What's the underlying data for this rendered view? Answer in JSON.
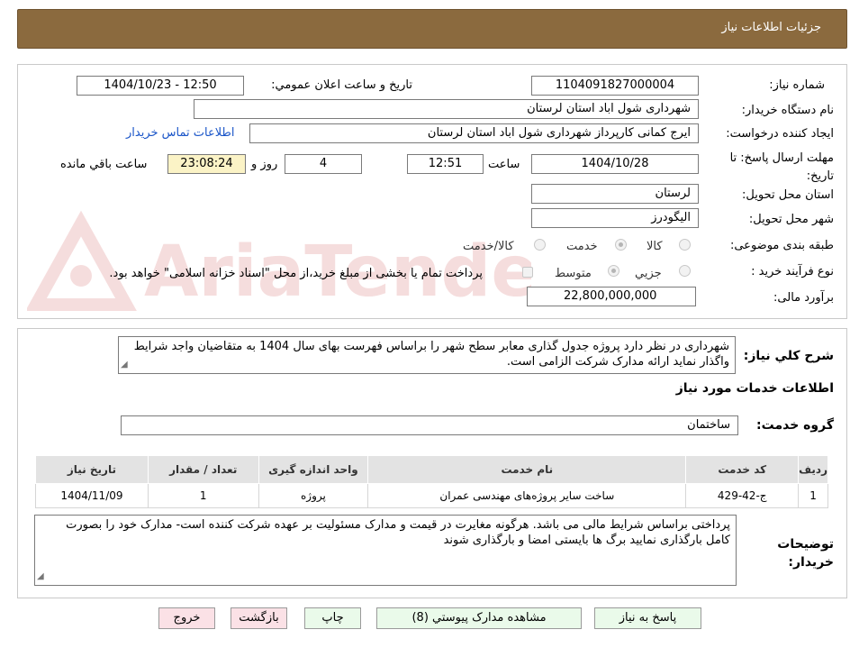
{
  "header": {
    "title": "جزئيات اطلاعات نياز"
  },
  "form": {
    "need_number_label": "شماره نياز:",
    "need_number": "1104091827000004",
    "announce_label": "تاريخ و ساعت اعلان عمومي:",
    "announce_value": "1404/10/23 - 12:50",
    "buyer_org_label": "نام دستگاه خريدار:",
    "buyer_org": "شهرداری شول اباد استان لرستان",
    "creator_label": "ايجاد کننده درخواست:",
    "creator": "ایرج کمانی کارپرداز شهرداری شول اباد استان لرستان",
    "contact_link": "اطلاعات تماس خريدار",
    "deadline_label": "مهلت ارسال پاسخ: تا تاريخ:",
    "deadline_date": "1404/10/28",
    "time_label": "ساعت",
    "deadline_time": "12:51",
    "days_value": "4",
    "days_label": "روز و",
    "remaining_time": "23:08:24",
    "remaining_label": "ساعت باقي مانده",
    "province_label": "استان محل تحويل:",
    "province": "لرستان",
    "city_label": "شهر محل تحويل:",
    "city": "الیگودرز",
    "category_label": "طبقه بندی موضوعی:",
    "category_options": [
      "کالا",
      "خدمت",
      "کالا/خدمت"
    ],
    "process_label": "نوع فرآيند خريد :",
    "process_options": [
      "جزيي",
      "متوسط"
    ],
    "payment_note": "پرداخت تمام يا بخشی از مبلغ خريد،از محل \"اسناد خزانه اسلامی\" خواهد بود.",
    "budget_label": "برآورد مالی:",
    "budget": "22,800,000,000"
  },
  "description": {
    "label": "شرح کلي نياز:",
    "text": "شهرداری در نظر دارد پروژه جدول گذاری معابر سطح شهر را براساس فهرست بهای سال 1404 به متقاضیان واجد شرایط واگذار نماید ارائه مدارک شرکت الزامی است."
  },
  "services": {
    "title": "اطلاعات خدمات مورد نياز",
    "group_label": "گروه خدمت:",
    "group_value": "ساختمان",
    "columns": [
      "رديف",
      "کد خدمت",
      "نام خدمت",
      "واحد اندازه گيری",
      "تعداد / مقدار",
      "تاريخ نياز"
    ],
    "rows": [
      [
        "1",
        "ج-42-429",
        "ساخت سایر پروژه‌های مهندسی عمران",
        "پروژه",
        "1",
        "1404/11/09"
      ]
    ]
  },
  "buyer_notes": {
    "label": "توضيحات خريدار:",
    "text": "پرداختی براساس شرایط مالی می باشد. هرگونه مغایرت در قیمت و مدارک مسئولیت بر عهده شرکت کننده است- مدارک خود را بصورت کامل بارگذاری نمایید برگ ها بایستی امضا و بارگذاری شوند"
  },
  "buttons": {
    "respond": "پاسخ به نياز",
    "attachments": "مشاهده مدارک پيوستي (8)",
    "print": "چاپ",
    "back": "بازگشت",
    "exit": "خروج"
  },
  "watermark": {
    "text": "AriaTender.net"
  },
  "colors": {
    "header_bg": "#8b6a3e",
    "link": "#1a55c8",
    "highlight": "#fbf3c6",
    "button_green": "#eafaea",
    "button_pink": "#fbe1e6"
  }
}
